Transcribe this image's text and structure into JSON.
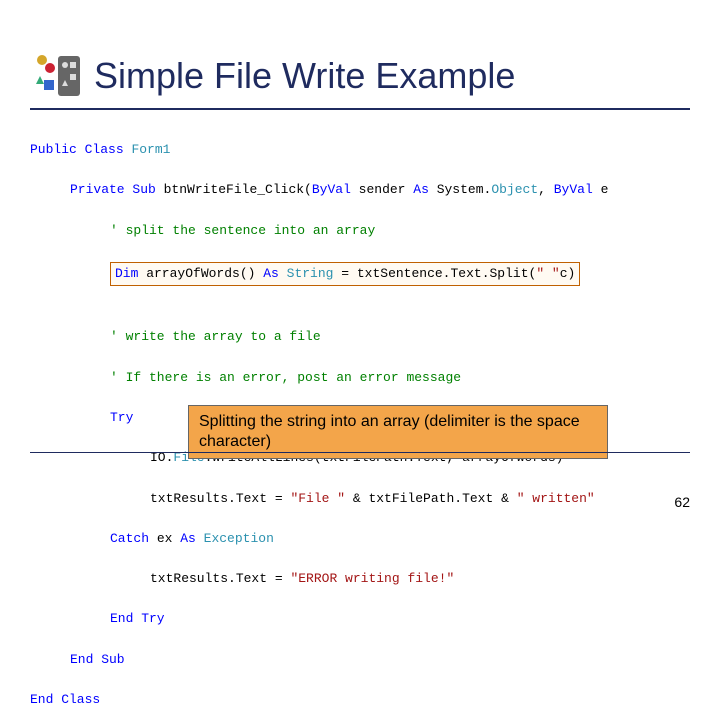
{
  "title": "Simple File Write Example",
  "code": {
    "l1_kw1": "Public Class",
    "l1_typ": "Form1",
    "l2_kw1": "Private Sub",
    "l2_name": " btnWriteFile_Click(",
    "l2_kw2": "ByVal",
    "l2_p1": " sender ",
    "l2_kw3": "As",
    "l2_p2": " System.",
    "l2_typ": "Object",
    "l2_p3": ", ",
    "l2_kw4": "ByVal",
    "l2_p4": " e",
    "l3_cm": "' split the sentence into an array",
    "l4_kw1": "Dim",
    "l4_a": " arrayOfWords() ",
    "l4_kw2": "As",
    "l4_b": " ",
    "l4_typ": "String",
    "l4_c": " = txtSentence.Text.Split(",
    "l4_str": "\" \"",
    "l4_d": "c)",
    "l5_cm": "' write the array to a file",
    "l6_cm": "' If there is an error, post an error message",
    "l7_kw": "Try",
    "l8_a": "IO.",
    "l8_typ": "File",
    "l8_b": ".WriteAllLines(txtFilePath.Text, arrayOfWords)",
    "l9_a": "txtResults.Text = ",
    "l9_s1": "\"File \"",
    "l9_b": " & txtFilePath.Text & ",
    "l9_s2": "\" written\"",
    "l10_kw1": "Catch",
    "l10_a": " ex ",
    "l10_kw2": "As",
    "l10_b": " ",
    "l10_typ": "Exception",
    "l11_a": "txtResults.Text = ",
    "l11_s": "\"ERROR writing file!\"",
    "l12_kw": "End Try",
    "l13_kw": "End Sub",
    "l14_kw": "End Class"
  },
  "annotation": "Splitting the string into an array (delimiter is the space character)",
  "page": "62"
}
